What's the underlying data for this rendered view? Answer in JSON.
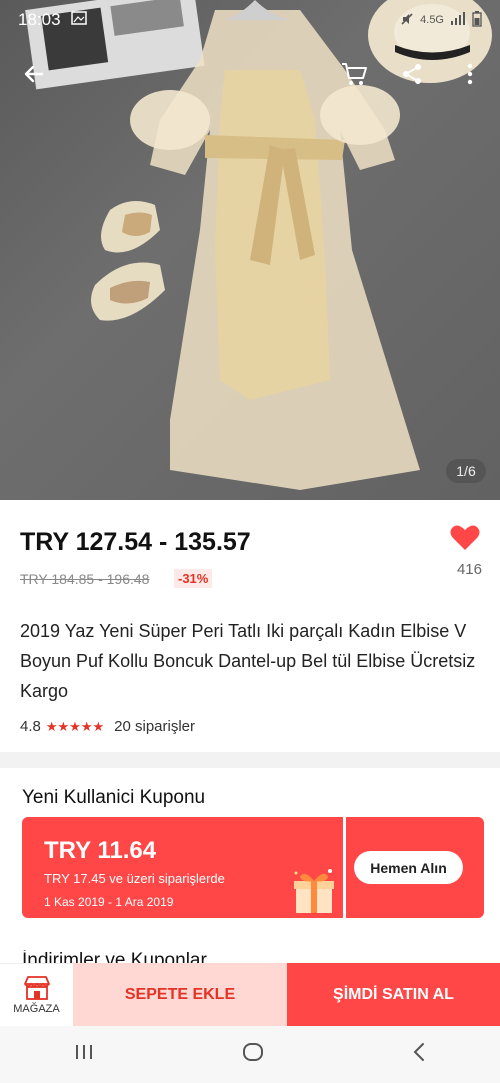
{
  "status": {
    "time": "18:03",
    "network": "4.5G"
  },
  "gallery": {
    "counter": "1/6"
  },
  "price": {
    "range": "TRY 127.54 - 135.57",
    "original": "TRY 184.85 - 196.48",
    "discount": "-31%"
  },
  "wishlist": {
    "count": "416"
  },
  "product": {
    "title": "2019 Yaz Yeni Süper Peri Tatlı Iki parçalı Kadın Elbise V Boyun Puf Kollu Boncuk Dantel-up Bel tül Elbise Ücretsiz Kargo",
    "rating": "4.8",
    "stars": "★★★★★",
    "orders": "20 siparişler"
  },
  "coupon": {
    "heading": "Yeni Kullanici Kuponu",
    "amount": "TRY 11.64",
    "condition": "TRY 17.45 ve üzeri siparişlerde",
    "dates": "1 Kas 2019 - 1 Ara 2019",
    "button": "Hemen Alın"
  },
  "next_section": {
    "heading": "İndirimler ve Kuponlar"
  },
  "actions": {
    "store": "MAĞAZA",
    "add_to_cart": "SEPETE EKLE",
    "buy_now": "ŞİMDİ SATIN AL"
  },
  "colors": {
    "accent": "#ff4747",
    "accent_light": "#ffd8d3",
    "price_red": "#e43225"
  }
}
